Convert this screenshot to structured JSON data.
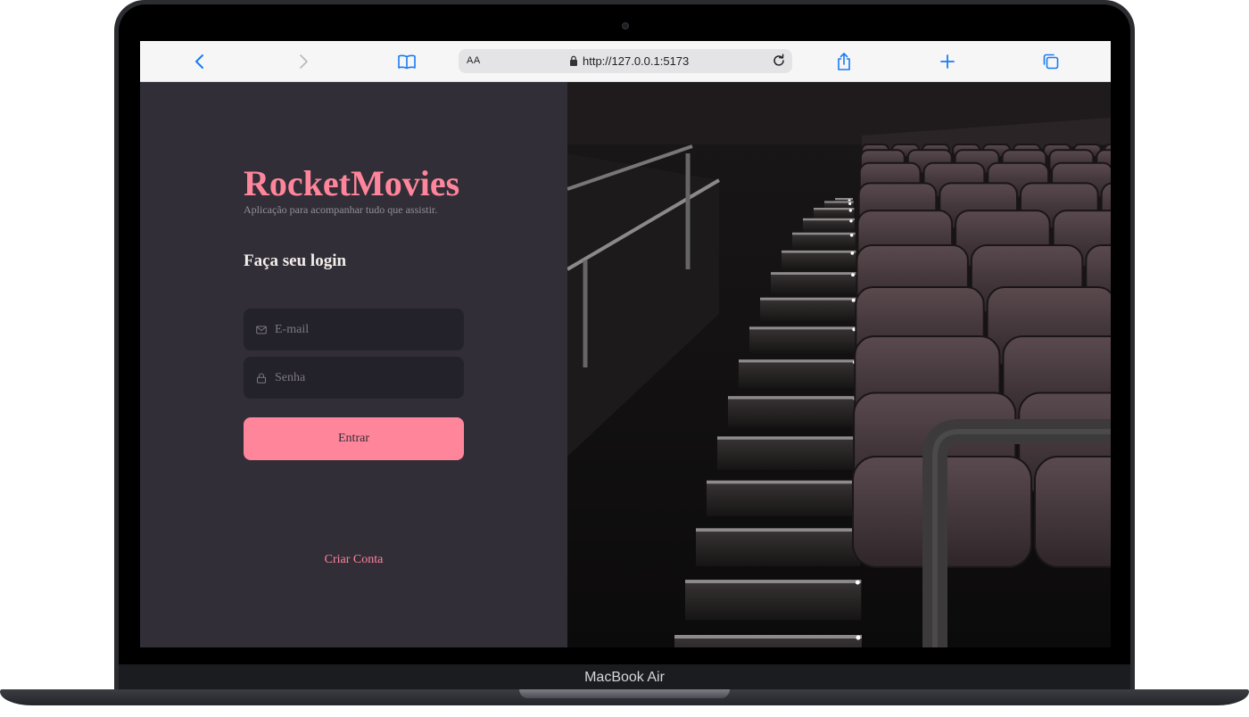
{
  "device": {
    "label": "MacBook Air"
  },
  "browser": {
    "reader_label": "AA",
    "url": "http://127.0.0.1:5173"
  },
  "app": {
    "brand": "RocketMovies",
    "tagline": "Aplicação para acompanhar tudo que assistir.",
    "login_title": "Faça seu login",
    "email_placeholder": "E-mail",
    "password_placeholder": "Senha",
    "submit_label": "Entrar",
    "create_account_label": "Criar Conta"
  },
  "colors": {
    "accent": "#ff859b",
    "panel": "#312e38",
    "input_bg": "#232129"
  },
  "icons": {
    "email": "mail-icon",
    "password": "lock-icon"
  }
}
